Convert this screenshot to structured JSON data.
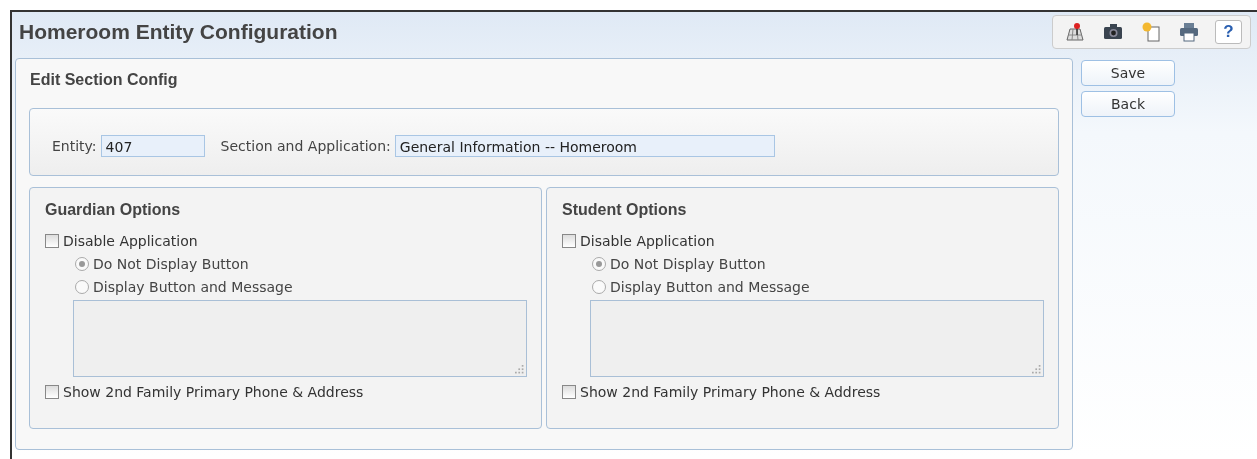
{
  "window": {
    "title": "Homeroom Entity Configuration"
  },
  "toolbar": [
    {
      "kind": "map"
    },
    {
      "kind": "camera"
    },
    {
      "kind": "new"
    },
    {
      "kind": "print"
    },
    {
      "kind": "help",
      "label": "?"
    }
  ],
  "section": {
    "title": "Edit Section Config",
    "entity": {
      "label": "Entity:",
      "value": "407"
    },
    "application": {
      "label": "Section and Application:",
      "value": "General Information -- Homeroom"
    }
  },
  "panels": [
    {
      "title": "Guardian Options",
      "disable": {
        "label": "Disable Application",
        "checked": false
      },
      "options": [
        {
          "label": "Do Not Display Button",
          "selected": true,
          "disabled": true
        },
        {
          "label": "Display Button and Message",
          "selected": false,
          "disabled": true
        }
      ],
      "show_second": {
        "label": "Show 2nd Family Primary Phone & Address",
        "checked": false
      }
    },
    {
      "title": "Student Options",
      "disable": {
        "label": "Disable Application",
        "checked": false
      },
      "options": [
        {
          "label": "Do Not Display Button",
          "selected": true,
          "disabled": true
        },
        {
          "label": "Display Button and Message",
          "selected": false,
          "disabled": true
        }
      ],
      "show_second": {
        "label": "Show 2nd Family Primary Phone & Address",
        "checked": false
      }
    }
  ],
  "buttons": [
    "Save",
    "Back"
  ]
}
